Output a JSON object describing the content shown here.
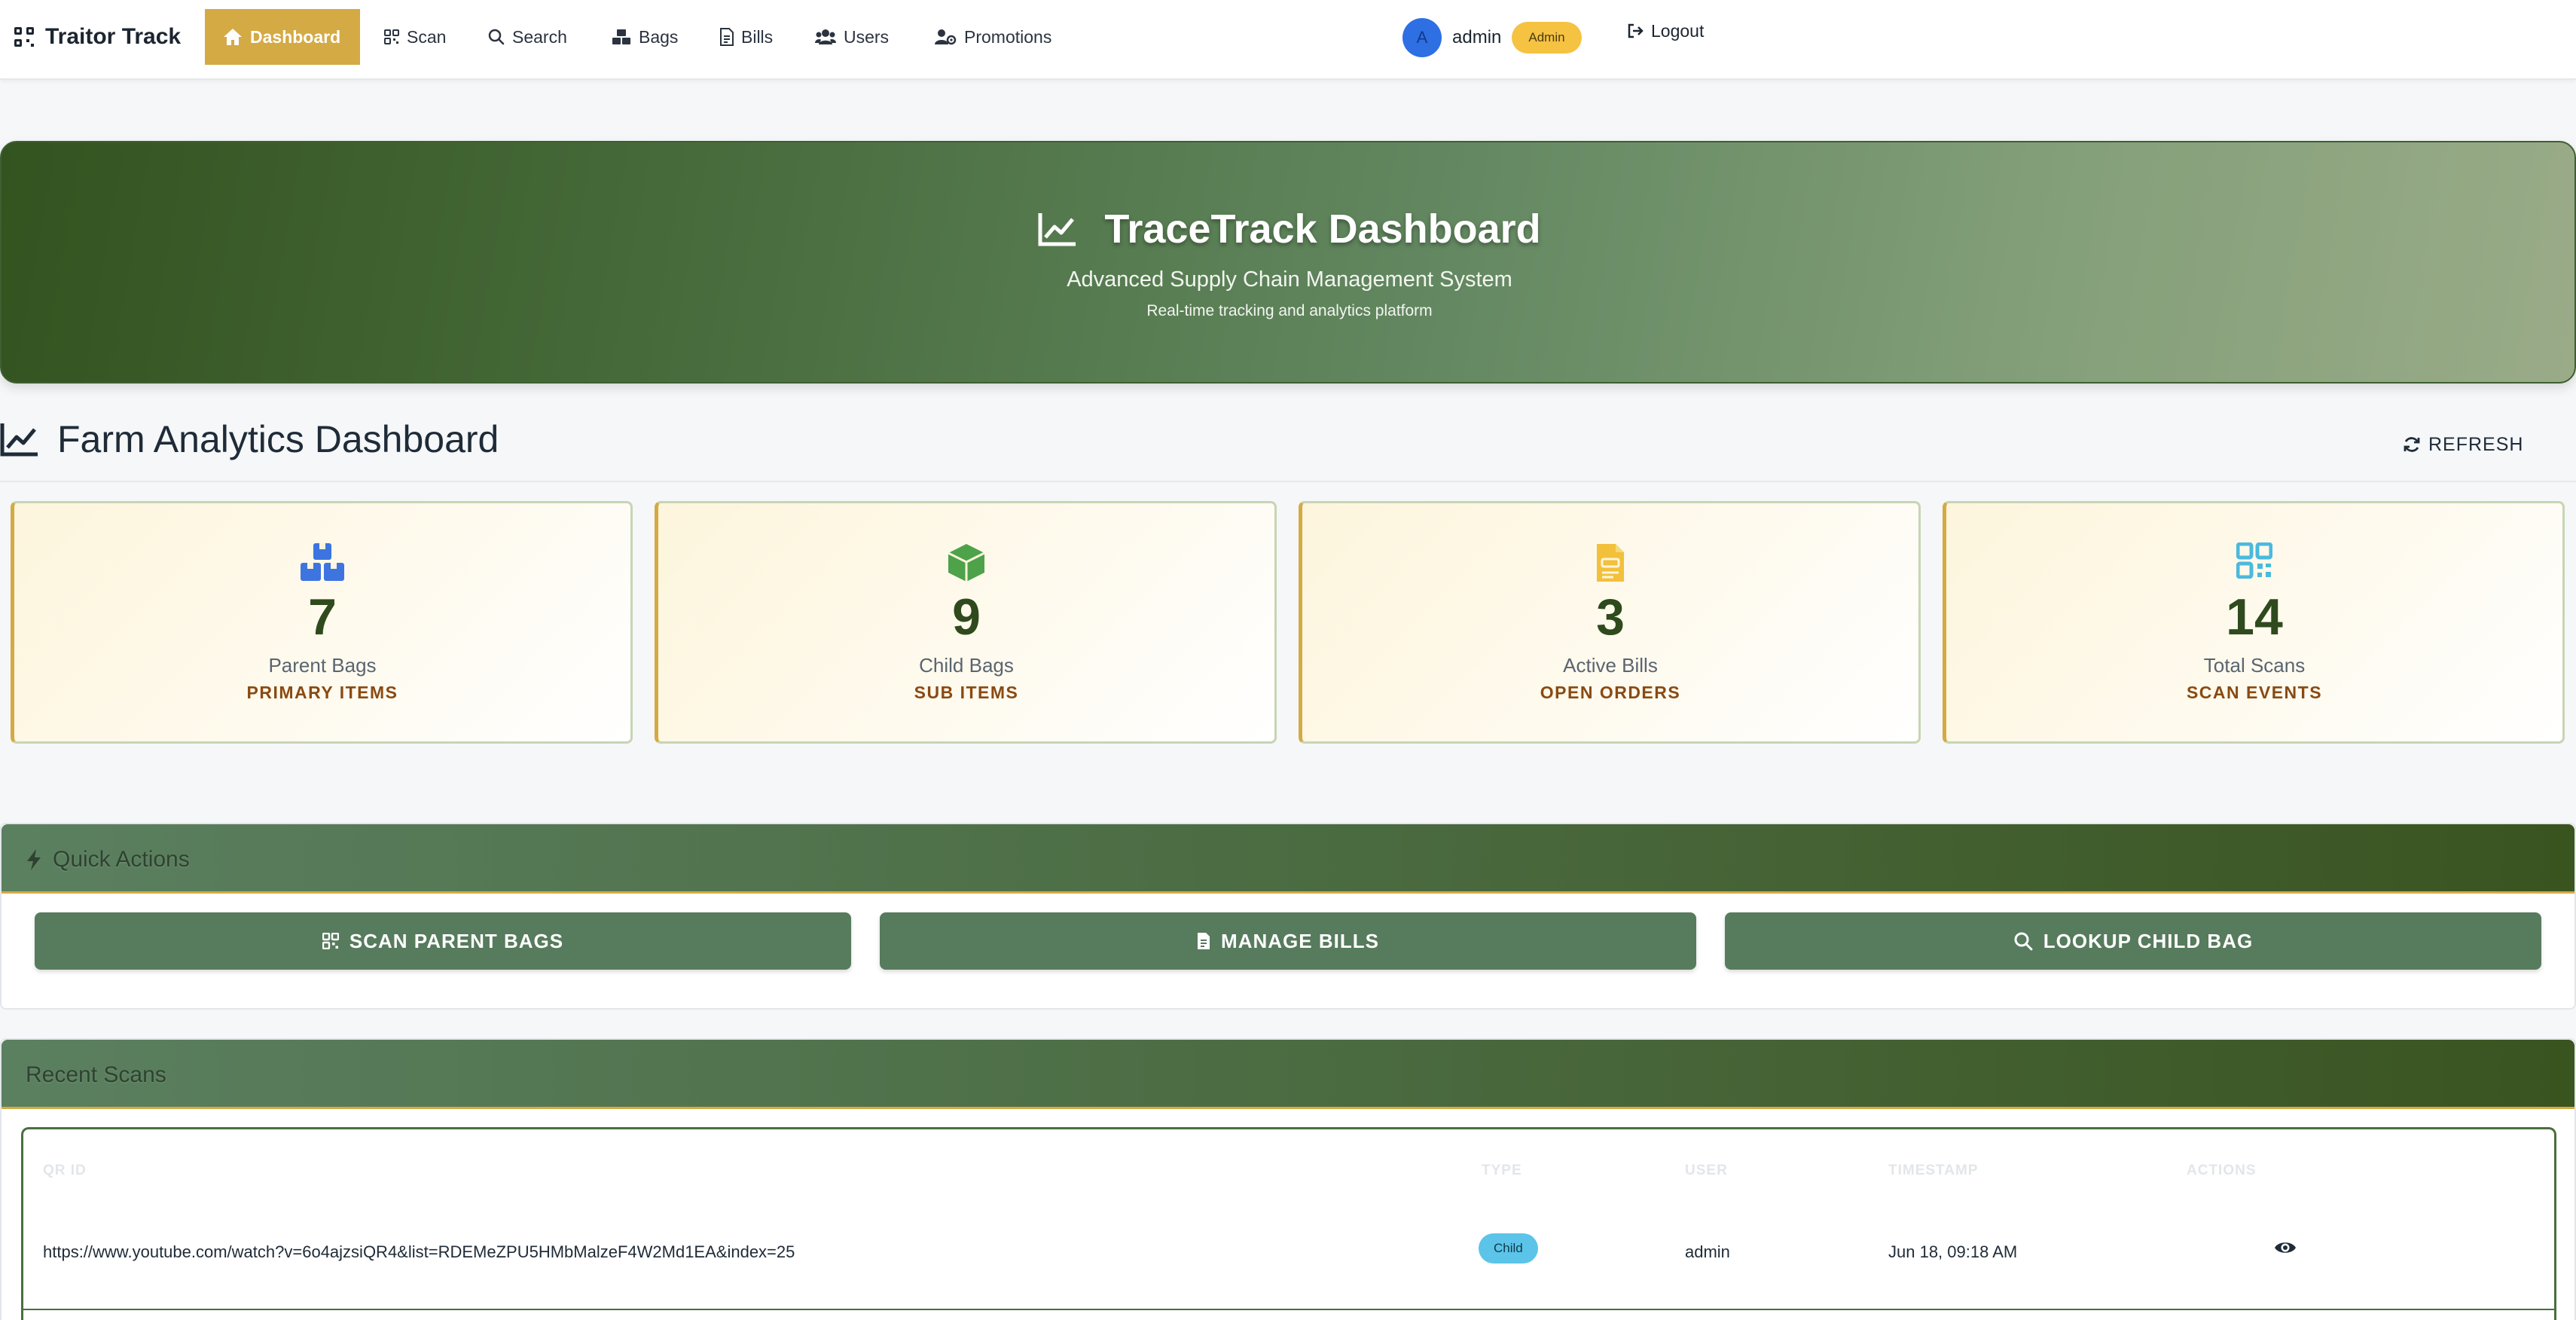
{
  "navbar": {
    "brand": "Traitor Track",
    "items": [
      {
        "label": "Dashboard",
        "active": true,
        "icon": "home-icon"
      },
      {
        "label": "Scan",
        "icon": "qrcode-icon"
      },
      {
        "label": "Search",
        "icon": "search-icon"
      },
      {
        "label": "Bags",
        "icon": "boxes-icon"
      },
      {
        "label": "Bills",
        "icon": "file-invoice-icon"
      },
      {
        "label": "Users",
        "icon": "users-icon"
      },
      {
        "label": "Promotions",
        "icon": "user-cog-icon"
      }
    ],
    "user": {
      "initial": "A",
      "name": "admin",
      "role": "Admin"
    },
    "logout": "Logout"
  },
  "hero": {
    "title": "TraceTrack Dashboard",
    "subtitle": "Advanced Supply Chain Management System",
    "tagline": "Real-time tracking and analytics platform"
  },
  "section": {
    "title": "Farm Analytics Dashboard",
    "refresh": "REFRESH"
  },
  "stats": [
    {
      "value": "7",
      "label": "Parent Bags",
      "sub": "PRIMARY ITEMS",
      "icon": "boxes-icon",
      "color": "#3d74e0"
    },
    {
      "value": "9",
      "label": "Child Bags",
      "sub": "SUB ITEMS",
      "icon": "box-icon",
      "color": "#4ea24a"
    },
    {
      "value": "3",
      "label": "Active Bills",
      "sub": "OPEN ORDERS",
      "icon": "file-invoice-icon",
      "color": "#f2c03a"
    },
    {
      "value": "14",
      "label": "Total Scans",
      "sub": "SCAN EVENTS",
      "icon": "qrcode-icon",
      "color": "#4cb9dd"
    }
  ],
  "quick_actions": {
    "title": "Quick Actions",
    "buttons": [
      {
        "label": "SCAN PARENT BAGS",
        "icon": "qrcode-icon"
      },
      {
        "label": "MANAGE BILLS",
        "icon": "file-invoice-icon"
      },
      {
        "label": "LOOKUP CHILD BAG",
        "icon": "search-icon"
      }
    ]
  },
  "recent_scans": {
    "title": "Recent Scans",
    "columns": [
      "QR ID",
      "TYPE",
      "USER",
      "TIMESTAMP",
      "ACTIONS"
    ],
    "rows": [
      {
        "qr_id": "https://www.youtube.com/watch?v=6o4ajzsiQR4&list=RDEMeZPU5HMbMalzeF4W2Md1EA&index=25",
        "type": "Child",
        "user": "admin",
        "timestamp": "Jun 18, 09:18 AM",
        "action_icon": "eye-icon"
      }
    ]
  }
}
